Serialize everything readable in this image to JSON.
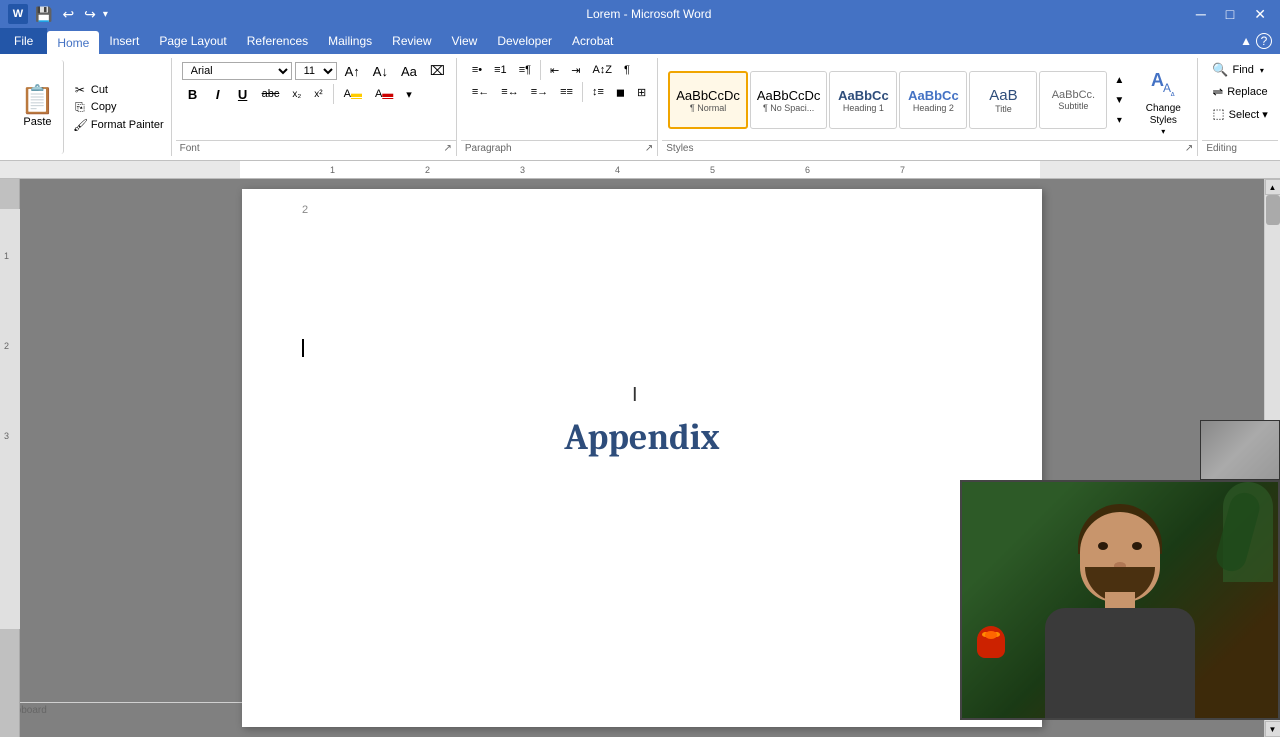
{
  "titlebar": {
    "title": "Lorem - Microsoft Word",
    "app_icon": "W",
    "min_btn": "─",
    "max_btn": "□",
    "close_btn": "✕"
  },
  "menu": {
    "items": [
      "File",
      "Home",
      "Insert",
      "Page Layout",
      "References",
      "Mailings",
      "Review",
      "View",
      "Developer",
      "Acrobat"
    ],
    "active": "Home"
  },
  "ribbon": {
    "clipboard": {
      "label": "Clipboard",
      "paste_label": "Paste",
      "cut_label": "Cut",
      "copy_label": "Copy",
      "format_painter_label": "Format Painter"
    },
    "font": {
      "label": "Font",
      "font_name": "Arial",
      "font_size": "11",
      "bold": "B",
      "italic": "I",
      "underline": "U",
      "strikethrough": "abc",
      "subscript": "x₂",
      "superscript": "x²"
    },
    "paragraph": {
      "label": "Paragraph"
    },
    "styles": {
      "label": "Styles",
      "normal": "AaBbCcDc",
      "normal_label": "¶ Normal",
      "no_spacing": "AaBbCcDc",
      "no_spacing_label": "¶ No Spaci...",
      "heading1": "AaBbCc",
      "heading1_label": "Heading 1",
      "heading2": "AaBbCc",
      "heading2_label": "Heading 2",
      "title": "AaB",
      "title_label": "Title",
      "subtitle": "AaBbCc.",
      "subtitle_label": "Subtitle",
      "change_styles": "Change\nStyles",
      "change_styles_label": "Change\nStyles"
    },
    "editing": {
      "label": "Editing",
      "find": "Find",
      "replace": "Replace",
      "select": "Select ▾"
    }
  },
  "document": {
    "page_number": "2",
    "appendix_title": "Appendix"
  },
  "toolbar_quick": {
    "save": "💾",
    "undo": "↩",
    "redo": "↪"
  }
}
